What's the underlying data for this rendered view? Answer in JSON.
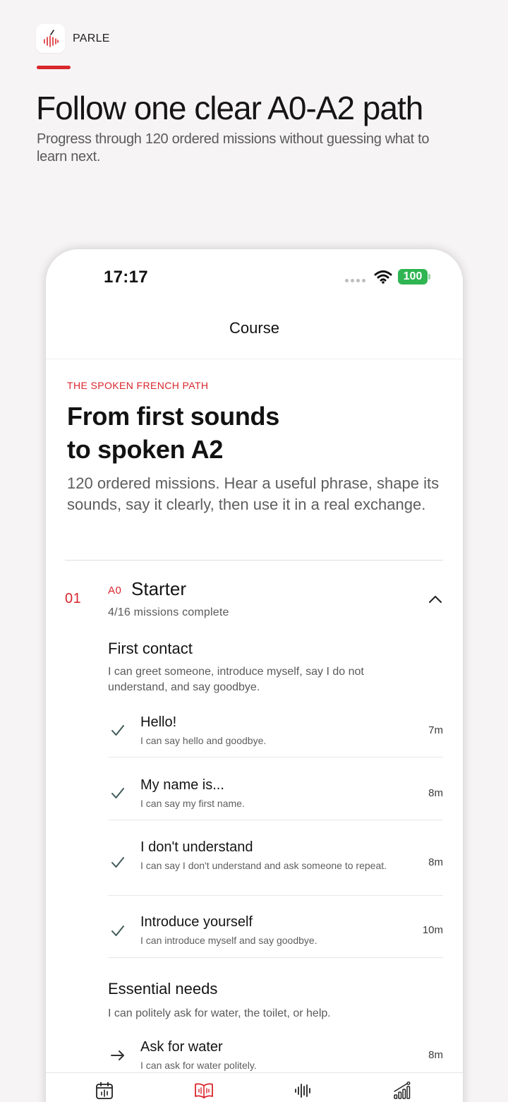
{
  "brand": {
    "name": "PARLE",
    "accent": "#d8262c"
  },
  "promo": {
    "headline": "Follow one clear A0-A2 path",
    "subhead": "Progress through 120 ordered missions without guessing what to learn next."
  },
  "status_bar": {
    "time": "17:17",
    "battery": "100",
    "icons": [
      "cellular-dots-icon",
      "wifi-icon",
      "battery-icon"
    ]
  },
  "nav": {
    "title": "Course"
  },
  "hero": {
    "eyebrow": "THE SPOKEN FRENCH PATH",
    "title_line1": "From first sounds",
    "title_line2": "to spoken A2",
    "description": "120 ordered missions. Hear a useful phrase, shape its sounds, say it clearly, then use it in a real exchange."
  },
  "unit": {
    "number": "01",
    "level": "A0",
    "title": "Starter",
    "progress": "4/16 missions complete",
    "sections": [
      {
        "title": "First contact",
        "description": "I can greet someone, introduce myself, say I do not understand, and say goodbye.",
        "missions": [
          {
            "title": "Hello!",
            "subtitle": "I can say hello and goodbye.",
            "duration": "7m",
            "status": "complete"
          },
          {
            "title": "My name is...",
            "subtitle": "I can say my first name.",
            "duration": "8m",
            "status": "complete"
          },
          {
            "title": "I don't understand",
            "subtitle": "I can say I don't understand and ask someone to repeat.",
            "duration": "8m",
            "status": "complete"
          },
          {
            "title": "Introduce yourself",
            "subtitle": "I can introduce myself and say goodbye.",
            "duration": "10m",
            "status": "complete"
          }
        ]
      },
      {
        "title": "Essential needs",
        "description": "I can politely ask for water, the toilet, or help.",
        "missions": [
          {
            "title": "Ask for water",
            "subtitle": "I can ask for water politely.",
            "duration": "8m",
            "status": "next"
          }
        ]
      }
    ]
  },
  "tabs": [
    {
      "icon": "calendar-icon",
      "active": false
    },
    {
      "icon": "book-icon",
      "active": true
    },
    {
      "icon": "waveform-icon",
      "active": false
    },
    {
      "icon": "progress-chart-icon",
      "active": false
    }
  ],
  "colors": {
    "accent": "#d8262c",
    "check": "#3f5a58",
    "battery": "#2fb552",
    "background": "#f6f4f4"
  }
}
